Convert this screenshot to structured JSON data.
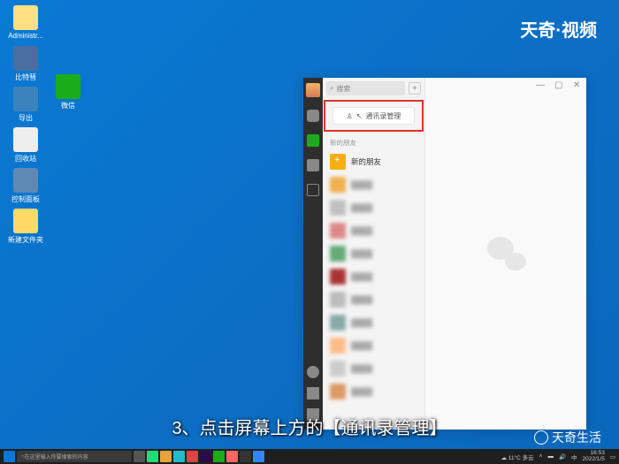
{
  "watermark": {
    "top": "天奇·视频",
    "bottom": "天奇生活"
  },
  "subtitle": "3、点击屏幕上方的【通讯录管理】",
  "desktop_icons": [
    {
      "label": "Administr..."
    },
    {
      "label": "比特彗"
    },
    {
      "label": "导出"
    },
    {
      "label": "回收站"
    },
    {
      "label": "控制面板"
    },
    {
      "label": "新建文件夹"
    },
    {
      "label": "微信"
    }
  ],
  "app": {
    "search_placeholder": "搜索",
    "contacts_manage_btn": "通讯录管理",
    "section_new": "新的朋友",
    "item_newfriend": "新的朋友",
    "titlebar": {
      "min": "—",
      "max": "▢",
      "close": "✕"
    }
  },
  "taskbar": {
    "search_placeholder": "在这里输入你要搜索的内容",
    "weather": "11°C 多云",
    "time": "16:53",
    "date": "2022/1/5"
  }
}
